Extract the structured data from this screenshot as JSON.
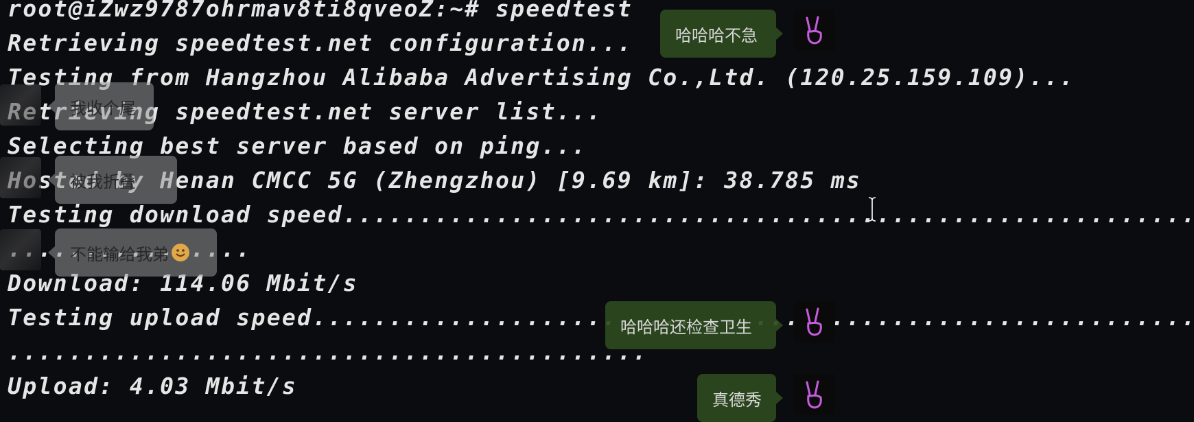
{
  "terminal": {
    "lines": [
      "root@iZwz9787ohrmav8ti8qveoZ:~# speedtest",
      "Retrieving speedtest.net configuration...",
      "Testing from Hangzhou Alibaba Advertising Co.,Ltd. (120.25.159.109)...",
      "Retrieving speedtest.net server list...",
      "Selecting best server based on ping...",
      "Hosted by Henan CMCC 5G (Zhengzhou) [9.69 km]: 38.785 ms",
      "Testing download speed.................................................................................",
      "................",
      "Download: 114.06 Mbit/s",
      "Testing upload speed...................................................................................",
      "..........................................",
      "Upload: 4.03 Mbit/s"
    ]
  },
  "danmaku": {
    "right": [
      {
        "text": "哈哈哈不急",
        "avatar_icon": "victory-hand-icon"
      },
      {
        "text": "哈哈哈还检查卫生",
        "avatar_icon": "victory-hand-icon"
      },
      {
        "text": "真德秀",
        "avatar_icon": "victory-hand-icon"
      }
    ],
    "left": [
      {
        "text": "我收个尾"
      },
      {
        "text": "被我折叠"
      },
      {
        "text": "不能输给我弟",
        "emoji": "smiling-face-icon"
      }
    ]
  },
  "colors": {
    "terminal_bg": "#0b0c10",
    "terminal_text": "#e6e6e6",
    "bubble_green": "#2e4a1e",
    "avatar_glow": "#c85ce0"
  }
}
